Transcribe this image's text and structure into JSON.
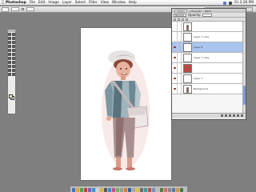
{
  "menubar": {
    "apple": "",
    "app_name": "Photoshop",
    "items": [
      "File",
      "Edit",
      "Image",
      "Layer",
      "Select",
      "Filter",
      "View",
      "Window",
      "Help"
    ],
    "clock": "Fri 2:26 PM"
  },
  "layers_palette": {
    "tabs": [
      "Layers",
      "Channels",
      "Paths"
    ],
    "blend_mode": "Normal",
    "opacity_label": "Opacity:",
    "layers": [
      {
        "name": "",
        "selected": false,
        "thumb": "figure",
        "visible": false
      },
      {
        "name": "Layer 7 copy",
        "selected": false,
        "thumb": "white",
        "visible": false
      },
      {
        "name": "Layer 6",
        "selected": true,
        "thumb": "white",
        "visible": true
      },
      {
        "name": "Layer 7 copy",
        "selected": false,
        "thumb": "white",
        "visible": true
      },
      {
        "name": "",
        "selected": false,
        "thumb": "red",
        "visible": true
      },
      {
        "name": "Layer 7",
        "selected": false,
        "thumb": "white",
        "visible": true
      },
      {
        "name": "Background",
        "selected": false,
        "thumb": "figure",
        "visible": true
      }
    ]
  },
  "colors": {
    "workspace": "#7f7f7f",
    "selected_layer": "#a9c4ee",
    "foreground_swatch": "#ffffd2"
  },
  "dock_colors": [
    "#3d6ec9",
    "#e7a431",
    "#4aa34a",
    "#c33",
    "#7c5bc2",
    "#2c9bd6",
    "#d6d6d6",
    "#e3b03b",
    "#555",
    "#3a86d4",
    "#cf4a8a",
    "#67b84e",
    "#999",
    "#d87c2a",
    "#315d9e",
    "#aaa",
    "#e0c04a",
    "#6b6b6b",
    "#3b9b9b",
    "#c14b3a",
    "#7090c0",
    "#bbb",
    "#4a7d3a",
    "#d66",
    "#888",
    "#5577aa",
    "#cc9944",
    "#447744"
  ]
}
